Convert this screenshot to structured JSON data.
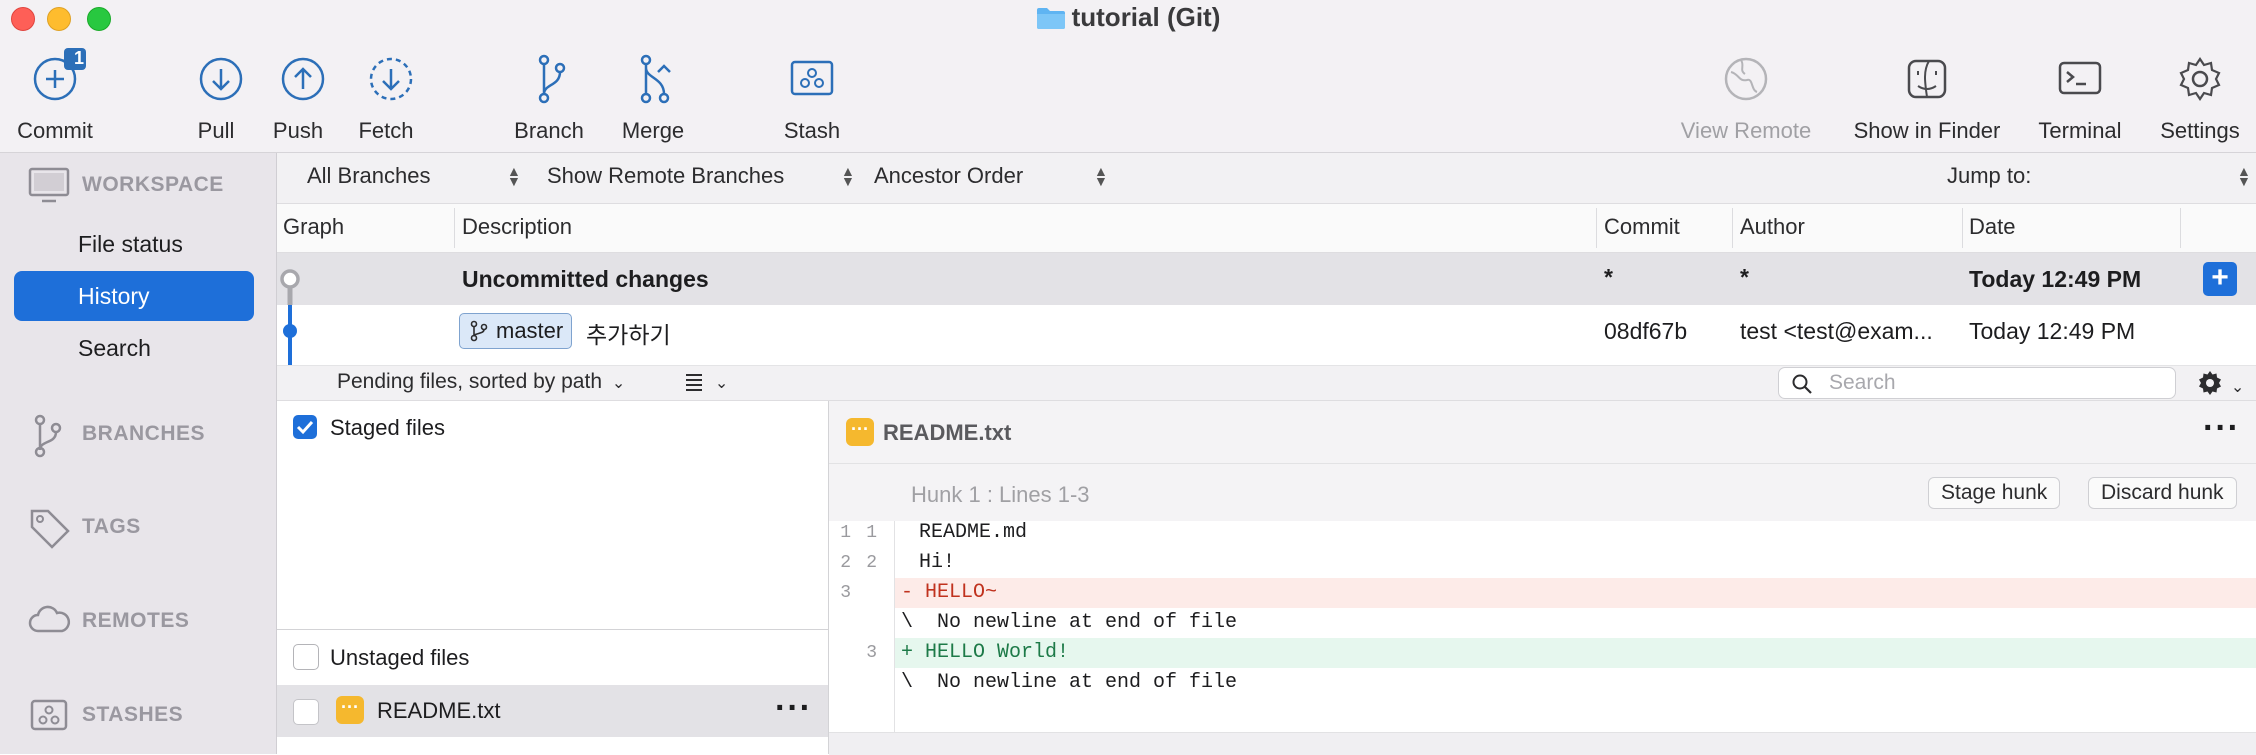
{
  "window": {
    "title": "tutorial (Git)"
  },
  "toolbar": {
    "commit": {
      "label": "Commit",
      "badge": "1"
    },
    "pull": "Pull",
    "push": "Push",
    "fetch": "Fetch",
    "branch": "Branch",
    "merge": "Merge",
    "stash": "Stash",
    "view_remote": "View Remote",
    "show_in_finder": "Show in Finder",
    "terminal": "Terminal",
    "settings": "Settings"
  },
  "sidebar": {
    "workspace": "WORKSPACE",
    "items": [
      "File status",
      "History",
      "Search"
    ],
    "selected": "History",
    "branches": "BRANCHES",
    "tags": "TAGS",
    "remotes": "REMOTES",
    "stashes": "STASHES"
  },
  "filters": {
    "branches": "All Branches",
    "remote": "Show Remote Branches",
    "order": "Ancestor Order",
    "jump": "Jump to:"
  },
  "columns": {
    "graph": "Graph",
    "description": "Description",
    "commit": "Commit",
    "author": "Author",
    "date": "Date"
  },
  "rows": [
    {
      "description": "Uncommitted changes",
      "commit": "*",
      "author": "*",
      "date": "Today 12:49 PM"
    },
    {
      "branch": "master",
      "description": "추가하기",
      "commit": "08df67b",
      "author": "test <test@exam...",
      "date": "Today 12:49 PM"
    }
  ],
  "pending": {
    "label": "Pending files, sorted by path",
    "search_placeholder": "Search"
  },
  "files": {
    "staged_label": "Staged files",
    "unstaged_label": "Unstaged files",
    "unstaged": [
      "README.txt"
    ]
  },
  "diff": {
    "filename": "README.txt",
    "hunk": "Hunk 1 : Lines 1-3",
    "stage_hunk": "Stage hunk",
    "discard_hunk": "Discard hunk",
    "lines": [
      {
        "old": "1",
        "new": "1",
        "text": "  README.md",
        "type": "context"
      },
      {
        "old": "2",
        "new": "2",
        "text": "  Hi!",
        "type": "context"
      },
      {
        "old": "3",
        "new": "",
        "text": "- HELLO~",
        "type": "removed"
      },
      {
        "old": "",
        "new": "",
        "text": "\\  No newline at end of file",
        "type": "note"
      },
      {
        "old": "",
        "new": "3",
        "text": "+ HELLO World!",
        "type": "added"
      },
      {
        "old": "",
        "new": "",
        "text": "\\  No newline at end of file",
        "type": "note"
      }
    ]
  },
  "colors": {
    "accent": "#1e6fd9",
    "removed_bg": "#fdebe8",
    "added_bg": "#e6f7ee",
    "removed_text": "#c0321e",
    "added_text": "#1d7a48",
    "modified": "#f5b82e"
  }
}
